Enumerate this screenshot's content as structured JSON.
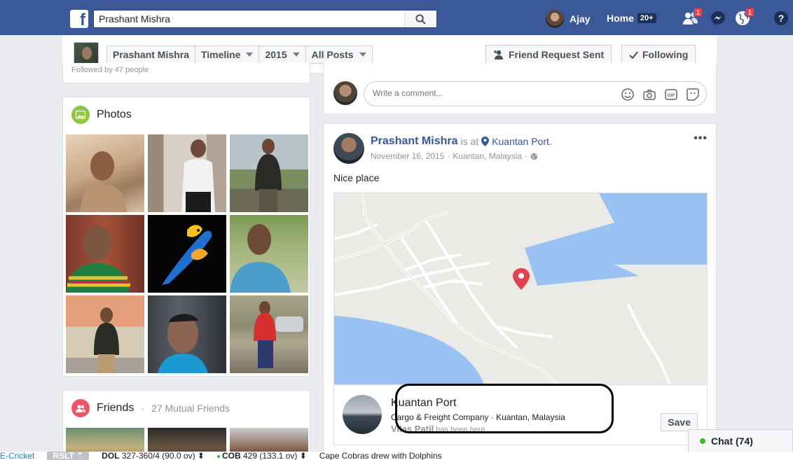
{
  "topbar": {
    "logo_icon": "facebook-f-icon",
    "search": {
      "value": "Prashant Mishra",
      "icon": "search-icon"
    },
    "user_name": "Ajay",
    "home_label": "Home",
    "home_count": "20+",
    "friend_requests_badge": "1",
    "notifications_badge": "1",
    "help_icon": "help-icon",
    "brand_color": "#3b5998"
  },
  "profile_strip": {
    "name": "Prashant Mishra",
    "timeline_label": "Timeline",
    "year_label": "2015",
    "posts_filter_label": "All Posts",
    "friend_request_label": "Friend Request Sent",
    "following_label": "Following"
  },
  "left_fragment": {
    "text": "Followed by 47 people"
  },
  "photos_card": {
    "title": "Photos",
    "accent": "#8dc63f"
  },
  "friends_card": {
    "title": "Friends",
    "separator": "·",
    "mutual": "27 Mutual Friends",
    "accent": "#f35369"
  },
  "composer": {
    "placeholder": "Write a comment..."
  },
  "post": {
    "author": "Prashant Mishra",
    "is_at": "is at",
    "place": "Kuantan Port.",
    "date": "November 16, 2015",
    "location": "Kuantan, Malaysia",
    "meta_separator": "·",
    "body": "Nice place",
    "more_icon": "more-dots-icon"
  },
  "place_card": {
    "name": "Kuantan Port",
    "subtitle": "Cargo & Freight Company · Kuantan, Malaysia",
    "visitor_name": "Vilas Patil",
    "visitor_suffix": "has been here",
    "save_label": "Save"
  },
  "chat": {
    "label": "Chat (74)"
  },
  "ticker": {
    "brand": "E-Cricket",
    "pill": "RSLT ⌃",
    "item1_team": "DOL",
    "item1_score": "327-360/4 (90.0 ov) ⬍",
    "item2_team": "COB",
    "item2_score": "429 (133.1 ov) ⬍",
    "item3": "Cape Cobras drew with Dolphins"
  }
}
